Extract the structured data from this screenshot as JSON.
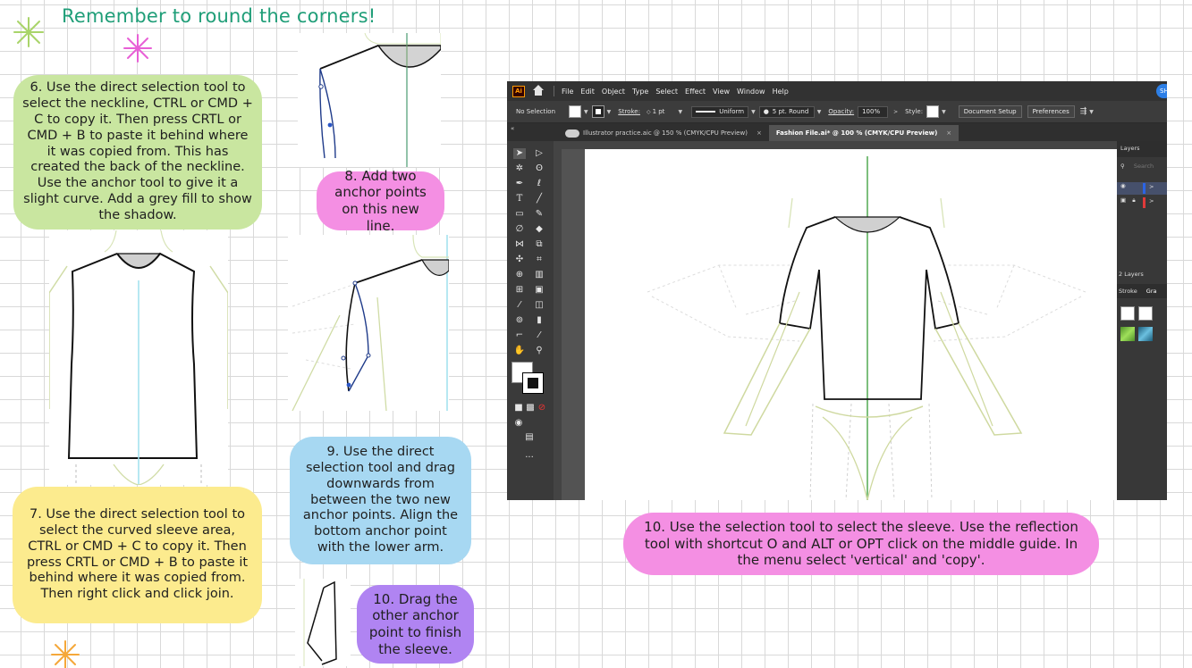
{
  "heading": "Remember to round the corners!",
  "steps": {
    "s6": "6. Use the direct selection tool to select the neckline, CTRL or CMD + C to copy it. Then press CRTL or CMD + B to paste it behind where it was copied from. This has created the back of the neckline. Use the anchor tool to give it a slight curve. Add a grey fill to show the shadow.",
    "s7": "7. Use the direct selection tool to select the curved sleeve area, CTRL or CMD + C to copy it. Then press CRTL or CMD + B to paste it behind where it was copied from. Then right click and click join.",
    "s8": "8. Add two anchor points on this new line.",
    "s9": "9. Use the direct selection tool and drag downwards from between the two new anchor points. Align the bottom anchor point with the lower arm.",
    "s10a": "10. Drag the other anchor point to finish the sleeve.",
    "s10b": "10. Use the selection tool to select the sleeve. Use the reflection tool with shortcut O and ALT or OPT click on the middle guide. In the menu select 'vertical' and 'copy'."
  },
  "illustrator": {
    "logo": "Ai",
    "menu": [
      "File",
      "Edit",
      "Object",
      "Type",
      "Select",
      "Effect",
      "View",
      "Window",
      "Help"
    ],
    "user": "SH",
    "control": {
      "selection": "No Selection",
      "stroke_label": "Stroke:",
      "stroke_value": "1 pt",
      "profile": "Uniform",
      "brush": "5 pt. Round",
      "opacity_label": "Opacity:",
      "opacity_value": "100%",
      "style_label": "Style:",
      "doc_setup": "Document Setup",
      "preferences": "Preferences"
    },
    "tabs": [
      {
        "label": "Illustrator practice.aic @ 150 % (CMYK/CPU Preview)",
        "close": "×"
      },
      {
        "label": "Fashion File.ai* @ 100 % (CMYK/CPU Preview)",
        "close": "×"
      }
    ],
    "panel": {
      "layers": "Layers",
      "search": "Search",
      "layer_count": "2 Layers",
      "stroke_tab": "Stroke",
      "gradient_tab": "Gra"
    },
    "more": "..."
  },
  "colors": {
    "heading": "#1f9e78",
    "green_note": "#c9e6a0",
    "pink_note": "#f48fe3",
    "yellow_note": "#fceb8e",
    "blue_note": "#a7d8f2",
    "purple_note": "#b084f2"
  }
}
